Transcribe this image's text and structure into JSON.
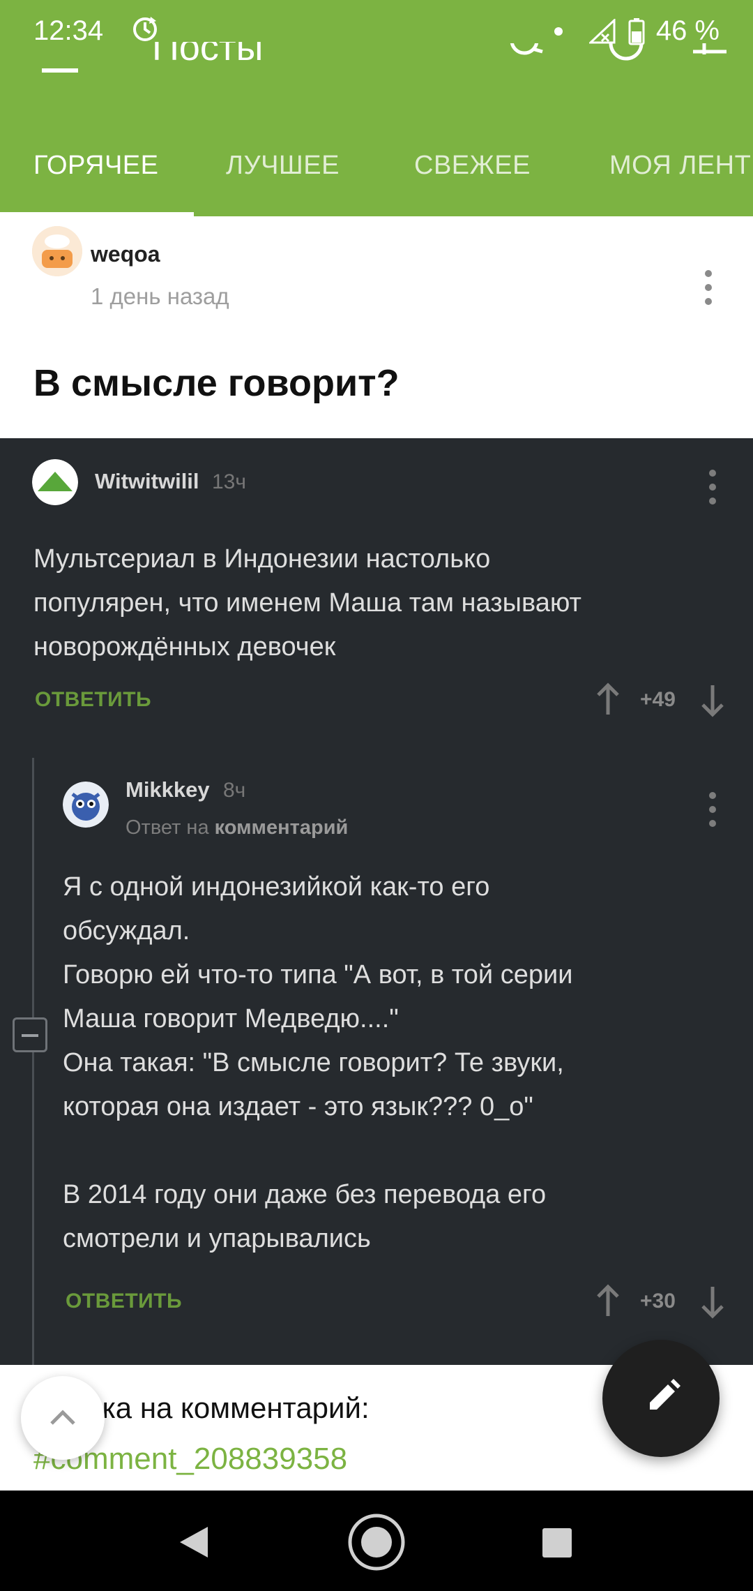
{
  "status": {
    "time": "12:34",
    "battery": "46 %"
  },
  "toolbar": {
    "title": "Посты"
  },
  "tabs": [
    {
      "label": "ГОРЯЧЕЕ",
      "active": true
    },
    {
      "label": "ЛУЧШЕЕ"
    },
    {
      "label": "СВЕЖЕЕ"
    },
    {
      "label": "МОЯ ЛЕНТ"
    }
  ],
  "post": {
    "author": "weqoa",
    "time": "1 день назад",
    "title": "В смысле говорит?"
  },
  "comments": [
    {
      "author": "Witwitwilil",
      "time": "13ч",
      "lines": [
        "Мультсериал в Индонезии настолько",
        "популярен, что именем Маша там называют",
        "новорождённых девочек"
      ],
      "reply_label": "ОТВЕТИТЬ",
      "score": "+49"
    },
    {
      "author": "Mikkkey",
      "time": "8ч",
      "reply_prefix": "Ответ на",
      "reply_target": "комментарий",
      "lines": [
        "Я с одной индонезийкой как-то его",
        "обсуждал.",
        "Говорю ей что-то типа \"А вот, в той серии",
        "Маша говорит Медведю....\"",
        "Она такая: \"В смысле говорит? Те звуки,",
        "которая она издает - это язык??? 0_о\"",
        "",
        "В 2014 году они даже без перевода его",
        "смотрели и упарывались"
      ],
      "reply_label": "ОТВЕТИТЬ",
      "score": "+30"
    }
  ],
  "sheet": {
    "label": "лка на комментарий:",
    "link": "#comment_208839358"
  },
  "colors": {
    "accent": "#7cb342",
    "dark_bg": "#262a2e"
  }
}
